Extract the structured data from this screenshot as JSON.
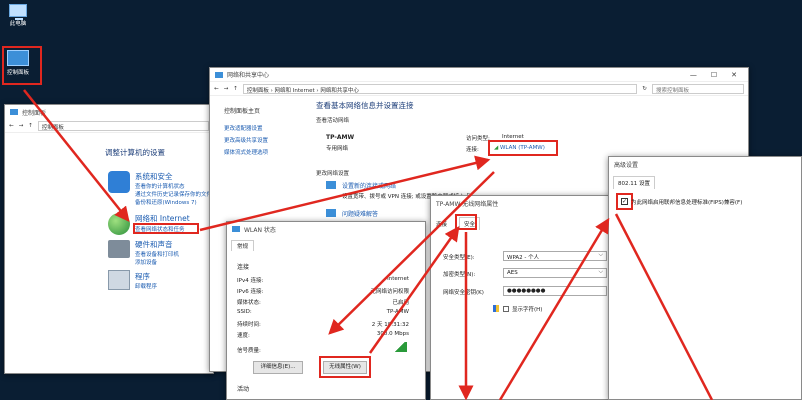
{
  "desktop": {
    "this_pc": "此电脑",
    "control_panel": "控制面板"
  },
  "cp_window": {
    "title": "控制面板",
    "path": "控制面板",
    "heading": "调整计算机的设置",
    "cat1_title": "系统和安全",
    "cat1_l1": "查看你的计算机状态",
    "cat1_l2": "通过文件历史记录保存你的文件备份副本",
    "cat1_l3": "备份和还原(Windows 7)",
    "cat2_title": "网络和 Internet",
    "cat2_l1": "查看网络状态和任务",
    "cat3_title": "硬件和声音",
    "cat3_l1": "查看设备和打印机",
    "cat3_l2": "添加设备",
    "cat4_title": "程序",
    "cat4_l1": "卸载程序"
  },
  "nsc_window": {
    "title": "网络和共享中心",
    "path_1": "控制面板",
    "path_2": "网络和 Internet",
    "path_3": "网络和共享中心",
    "search_placeholder": "搜索控制面板",
    "side_home": "控制面板主页",
    "side_1": "更改适配器设置",
    "side_2": "更改高级共享设置",
    "side_3": "媒体流式处理选项",
    "heading": "查看基本网络信息并设置连接",
    "active_label": "查看活动网络",
    "net_name": "TP-AMW",
    "net_type": "专用网络",
    "access_type_label": "访问类型:",
    "access_type_value": "Internet",
    "conn_label": "连接:",
    "conn_value": "WLAN (TP-AMW)",
    "change_label": "更改网络设置",
    "change_1_title": "设置新的连接或网络",
    "change_1_desc": "设置宽带、拨号或 VPN 连接; 或设置路由器或接入点。",
    "change_2_title": "问题疑难解答"
  },
  "wlan_status": {
    "title": "WLAN 状态",
    "tab": "常规",
    "section": "连接",
    "ipv4_k": "IPv4 连接:",
    "ipv4_v": "Internet",
    "ipv6_k": "IPv6 连接:",
    "ipv6_v": "无网络访问权限",
    "media_k": "媒体状态:",
    "media_v": "已启用",
    "ssid_k": "SSID:",
    "ssid_v": "TP-AMW",
    "dur_k": "持续时间:",
    "dur_v": "2 天 18:31:32",
    "speed_k": "速度:",
    "speed_v": "300.0 Mbps",
    "quality_k": "信号质量:",
    "details_btn": "详细信息(E)...",
    "wireless_btn": "无线属性(W)",
    "activity": "活动"
  },
  "wlan_props": {
    "title": "TP-AMW 无线网络属性",
    "tab_conn": "连接",
    "tab_sec": "安全",
    "sec_type_k": "安全类型(E):",
    "sec_type_v": "WPA2 - 个人",
    "enc_type_k": "加密类型(N):",
    "enc_type_v": "AES",
    "key_k": "网络安全密钥(K)",
    "key_v": "●●●●●●●●",
    "show_chars": "显示字符(H)"
  },
  "advanced": {
    "title": "高级设置",
    "tab": "802.11 设置",
    "fips": "为此网络启用联邦信息处理标准(FIPS)兼容(F)"
  },
  "colors": {
    "accent": "#e0271f",
    "link": "#1a5bb0",
    "desktop": "#0a1e33"
  }
}
